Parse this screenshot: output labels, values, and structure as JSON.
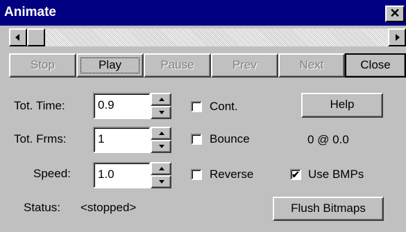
{
  "window": {
    "title": "Animate",
    "close_glyph": "✕"
  },
  "toolbar": {
    "stop": "Stop",
    "play": "Play",
    "pause": "Pause",
    "prev": "Prev",
    "next": "Next",
    "close": "Close"
  },
  "fields": {
    "tot_time_label": "Tot. Time:",
    "tot_time_value": "0.9",
    "tot_frms_label": "Tot. Frms:",
    "tot_frms_value": "1",
    "speed_label": "Speed:",
    "speed_value": "1.0"
  },
  "options": {
    "cont": "Cont.",
    "cont_checked": false,
    "bounce": "Bounce",
    "bounce_checked": false,
    "reverse": "Reverse",
    "reverse_checked": false,
    "use_bmps": "Use BMPs",
    "use_bmps_checked": true
  },
  "buttons": {
    "help": "Help",
    "flush": "Flush Bitmaps"
  },
  "frame_info": "0 @ 0.0",
  "status": {
    "label": "Status:",
    "value": "<stopped>"
  },
  "icons": [
    "close-icon",
    "scroll-left-icon",
    "scroll-right-icon",
    "spin-up-icon",
    "spin-down-icon",
    "checkmark-icon"
  ]
}
